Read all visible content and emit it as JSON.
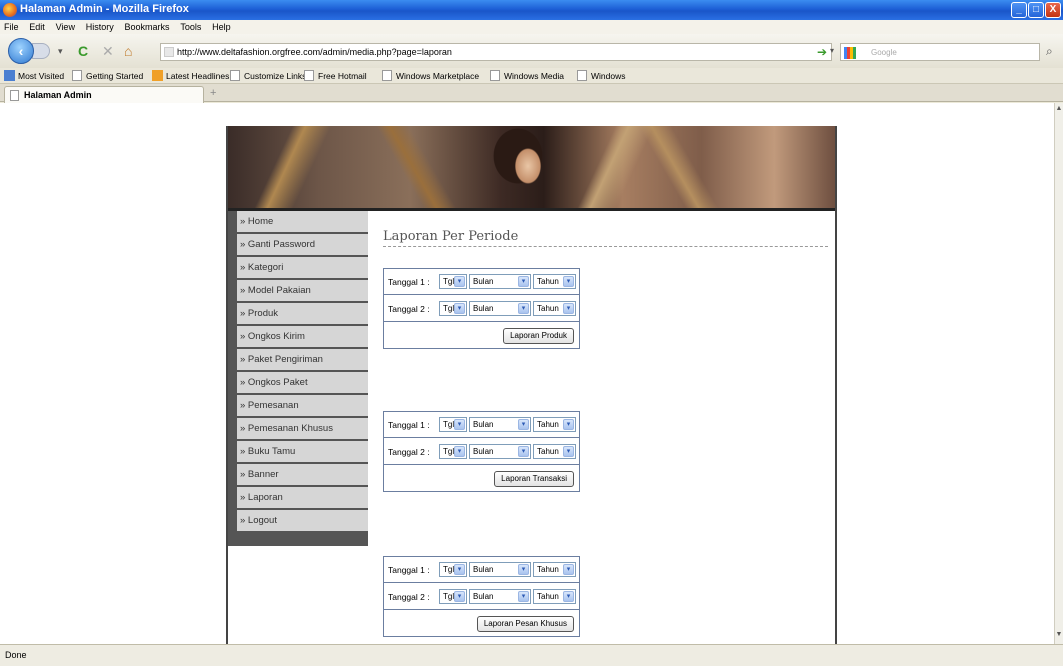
{
  "window": {
    "title": "Halaman Admin - Mozilla Firefox"
  },
  "menu": [
    "File",
    "Edit",
    "View",
    "History",
    "Bookmarks",
    "Tools",
    "Help"
  ],
  "nav": {
    "url": "http://www.deltafashion.orgfree.com/admin/media.php?page=laporan",
    "search_placeholder": "Google"
  },
  "bookmarks": [
    "Most Visited",
    "Getting Started",
    "Latest Headlines",
    "Customize Links",
    "Free Hotmail",
    "Windows Marketplace",
    "Windows Media",
    "Windows"
  ],
  "tab": {
    "label": "Halaman Admin",
    "new_tab": "+"
  },
  "sidebar": [
    "» Home",
    "» Ganti Password",
    "» Kategori",
    "» Model Pakaian",
    "» Produk",
    "» Ongkos Kirim",
    "» Paket Pengiriman",
    "» Ongkos Paket",
    "» Pemesanan",
    "» Pemesanan Khusus",
    "» Buku Tamu",
    "» Banner",
    "» Laporan",
    "» Logout"
  ],
  "main": {
    "title": "Laporan Per Periode",
    "forms": [
      {
        "label1": "Tanggal 1 :",
        "label2": "Tanggal 2 :",
        "tgl": "Tgl",
        "bulan": "Bulan",
        "tahun": "Tahun",
        "button": "Laporan Produk"
      },
      {
        "label1": "Tanggal 1 :",
        "label2": "Tanggal 2 :",
        "tgl": "Tgl",
        "bulan": "Bulan",
        "tahun": "Tahun",
        "button": "Laporan Transaksi"
      },
      {
        "label1": "Tanggal 1 :",
        "label2": "Tanggal 2 :",
        "tgl": "Tgl",
        "bulan": "Bulan",
        "tahun": "Tahun",
        "button": "Laporan Pesan Khusus"
      }
    ]
  },
  "status": {
    "text": "Done"
  },
  "icons": {
    "dropdown": "▾",
    "back": "‹",
    "reload": "C",
    "stop": "✕",
    "home": "⌂",
    "go": "➔",
    "search": "⌕",
    "minimize": "_",
    "maximize": "□",
    "close": "X"
  }
}
